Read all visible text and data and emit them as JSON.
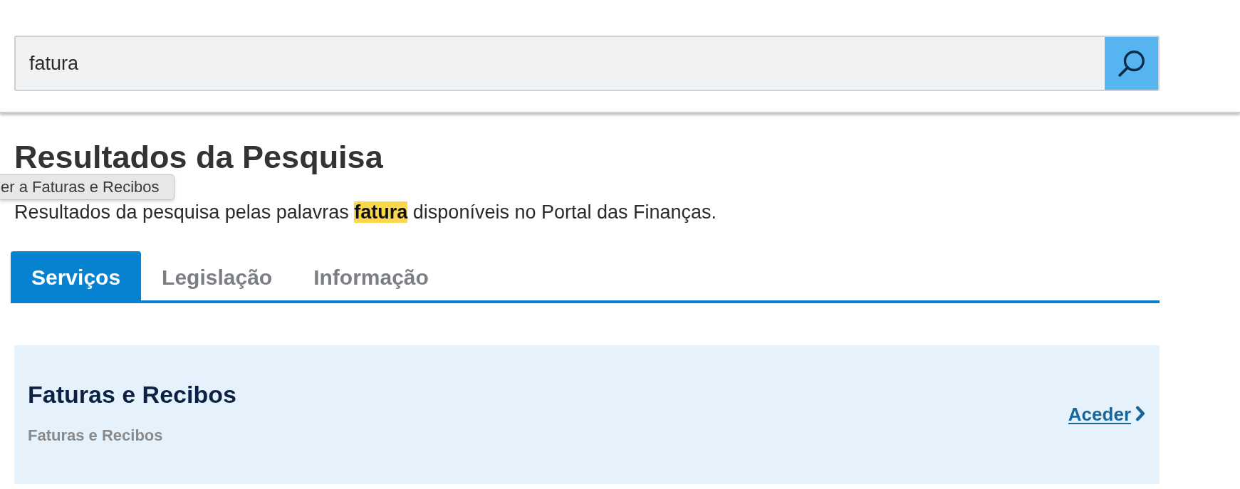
{
  "search": {
    "value": "fatura"
  },
  "heading": "Resultados da Pesquisa",
  "tooltip": "er a Faturas e Recibos",
  "summary": "Resultados da pesquisa pelas palavras **fatura** disponíveis no Portal das Finanças.",
  "tabs": [
    {
      "label": "Serviços",
      "selected": true
    },
    {
      "label": "Legislação",
      "selected": false
    },
    {
      "label": "Informação",
      "selected": false
    }
  ],
  "results": [
    {
      "title": "Faturas e Recibos",
      "description": "Faturas e Recibos",
      "link": "Aceder"
    }
  ]
}
